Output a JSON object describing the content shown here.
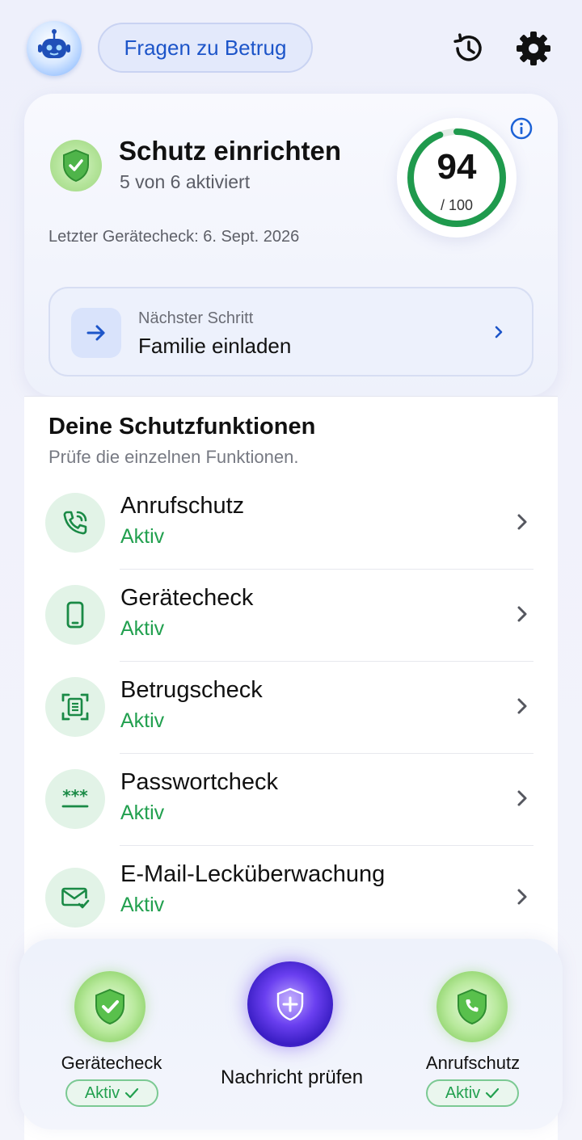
{
  "header": {
    "ask_button_label": "Fragen zu Betrug",
    "history_icon": "history-icon",
    "settings_icon": "gear-icon"
  },
  "setup": {
    "title": "Schutz einrichten",
    "progress_text": "5 von 6 aktiviert",
    "last_check": "Letzter Gerätecheck: 6. Sept. 2026",
    "score": "94",
    "score_max": "/ 100",
    "score_value": 94,
    "score_total": 100,
    "next_step_label": "Nächster Schritt",
    "next_step_value": "Familie einladen"
  },
  "features": {
    "title": "Deine Schutzfunktionen",
    "subtitle": "Prüfe die einzelnen Funktionen.",
    "items": [
      {
        "name": "Anrufschutz",
        "status": "Aktiv",
        "icon": "phone-shield-icon"
      },
      {
        "name": "Gerätecheck",
        "status": "Aktiv",
        "icon": "smartphone-icon"
      },
      {
        "name": "Betrugscheck",
        "status": "Aktiv",
        "icon": "scan-document-icon"
      },
      {
        "name": "Passwortcheck",
        "status": "Aktiv",
        "icon": "password-icon"
      },
      {
        "name": "E-Mail-Lecküberwachung",
        "status": "Aktiv",
        "icon": "mail-check-icon"
      }
    ]
  },
  "dock": {
    "left_label": "Gerätecheck",
    "left_status": "Aktiv",
    "center_label": "Nachricht prüfen",
    "right_label": "Anrufschutz",
    "right_status": "Aktiv"
  },
  "colors": {
    "accent_blue": "#1d55c9",
    "active_green": "#22a04f",
    "ring_green": "#1f9a4d"
  }
}
